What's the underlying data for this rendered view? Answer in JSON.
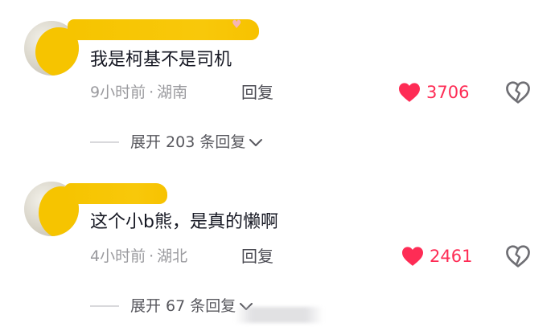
{
  "comments": [
    {
      "text": "我是柯基不是司机",
      "time": "9小时前",
      "location": "湖南",
      "reply_label": "回复",
      "likes": "3706",
      "expand_label": "展开 203 条回复"
    },
    {
      "text": "这个小b熊，是真的懒啊",
      "time": "4小时前",
      "location": "湖北",
      "reply_label": "回复",
      "likes": "2461",
      "expand_label": "展开 67 条回复"
    }
  ],
  "meta_separator": "·",
  "icons": {
    "like": "heart-filled-icon",
    "dislike": "broken-heart-icon",
    "expand": "chevron-down-icon"
  },
  "colors": {
    "like": "#fe2c55",
    "redaction": "#f6c400",
    "meta": "#9a9a9e"
  }
}
